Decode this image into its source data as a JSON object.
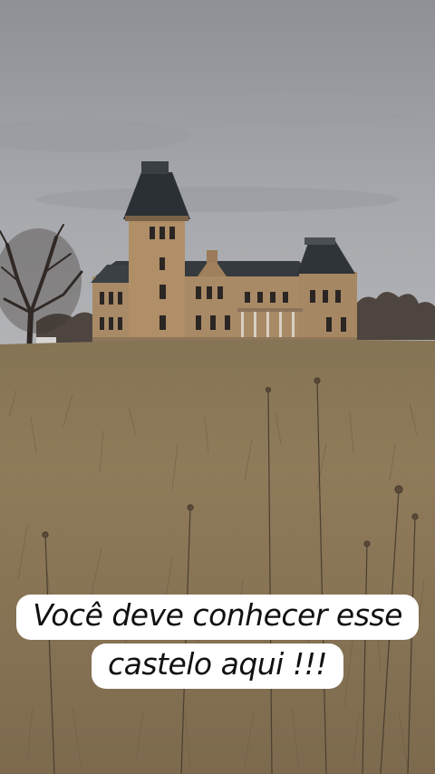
{
  "caption": {
    "line1": "Você deve conhecer esse",
    "line2": "castelo aqui !!!"
  },
  "colors": {
    "sky": "#9ea0a6",
    "field": "#8a7656",
    "building_stone": "#a98b66",
    "roof": "#2f3436",
    "caption_bg": "#ffffff",
    "caption_text": "#111111"
  }
}
